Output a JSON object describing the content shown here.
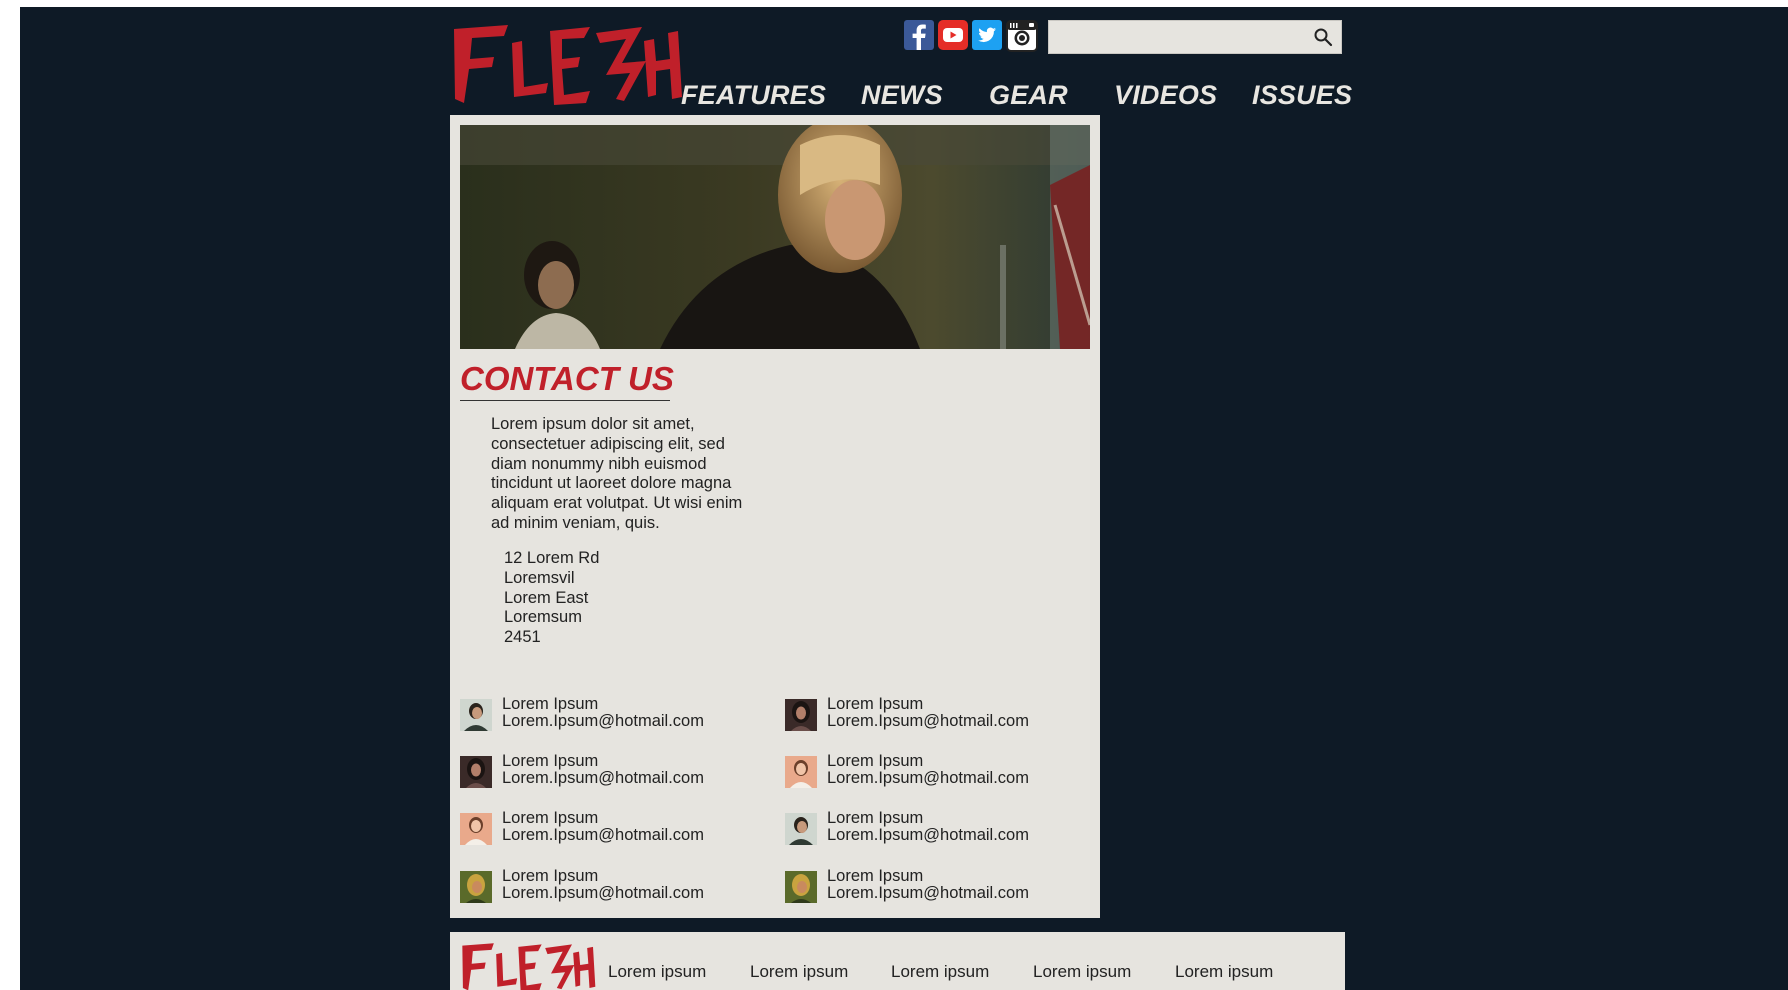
{
  "brand": {
    "logo_text": "FLESH",
    "color": "#c0202a"
  },
  "colors": {
    "background": "#0e1a26",
    "panel": "#e6e4df",
    "accent": "#c0202a",
    "nav_text": "#e8e6e1"
  },
  "social": [
    {
      "name": "facebook-icon",
      "color": "#3b5998"
    },
    {
      "name": "youtube-icon",
      "color": "#e52d27"
    },
    {
      "name": "twitter-icon",
      "color": "#1da1f2"
    },
    {
      "name": "instagram-icon",
      "color": "#222222"
    }
  ],
  "search": {
    "value": "",
    "placeholder": ""
  },
  "nav": [
    "FEATURES",
    "NEWS",
    "GEAR",
    "VIDEOS",
    "ISSUES"
  ],
  "page": {
    "title": "CONTACT US",
    "intro": "Lorem ipsum dolor sit amet, consectetuer adipiscing elit, sed diam nonummy nibh euismod tincidunt ut laoreet dolore magna aliquam erat volutpat. Ut wisi enim ad minim veniam, quis.",
    "address": [
      "12 Lorem Rd",
      "Loremsvil",
      "Lorem East",
      "Loremsum",
      "2451"
    ]
  },
  "contacts": [
    {
      "name": "Lorem Ipsum",
      "email": "Lorem.Ipsum@hotmail.com"
    },
    {
      "name": "Lorem Ipsum",
      "email": "Lorem.Ipsum@hotmail.com"
    },
    {
      "name": "Lorem Ipsum",
      "email": "Lorem.Ipsum@hotmail.com"
    },
    {
      "name": "Lorem Ipsum",
      "email": "Lorem.Ipsum@hotmail.com"
    },
    {
      "name": "Lorem Ipsum",
      "email": "Lorem.Ipsum@hotmail.com"
    },
    {
      "name": "Lorem Ipsum",
      "email": "Lorem.Ipsum@hotmail.com"
    },
    {
      "name": "Lorem Ipsum",
      "email": "Lorem.Ipsum@hotmail.com"
    },
    {
      "name": "Lorem Ipsum",
      "email": "Lorem.Ipsum@hotmail.com"
    }
  ],
  "footer": {
    "links": [
      "Lorem ipsum",
      "Lorem ipsum",
      "Lorem ipsum",
      "Lorem ipsum",
      "Lorem ipsum"
    ]
  }
}
